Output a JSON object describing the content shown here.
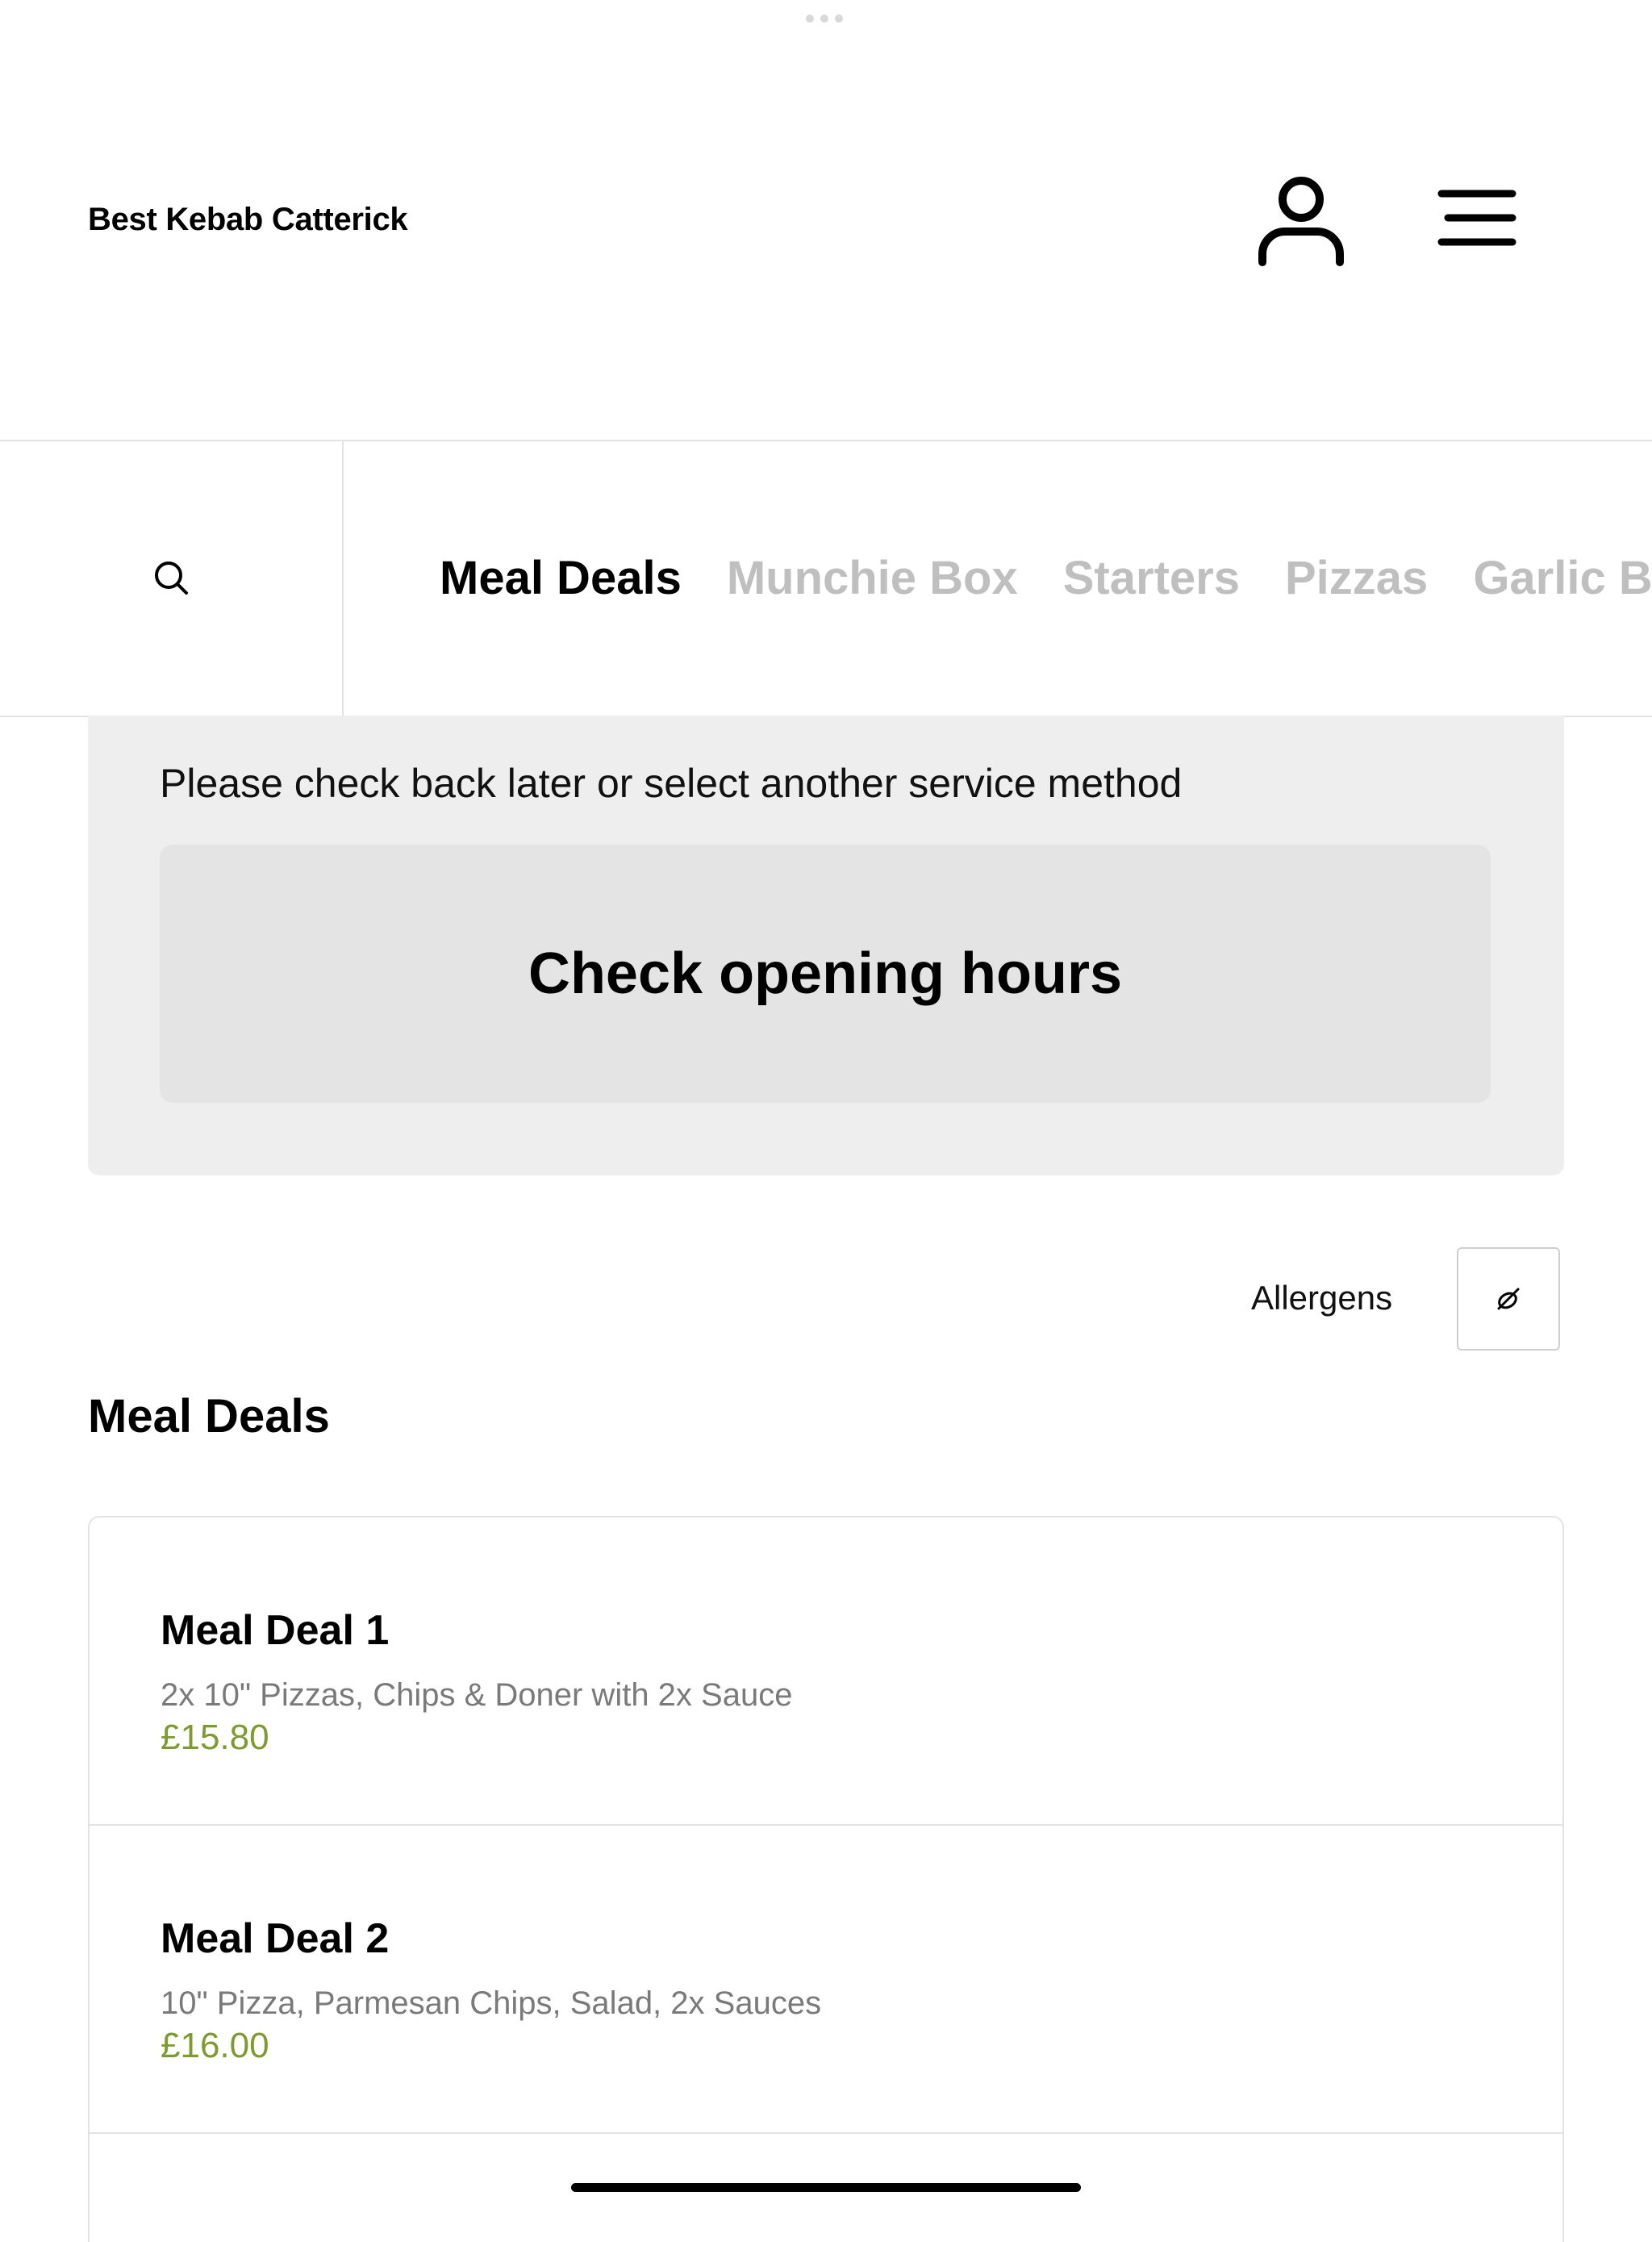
{
  "header": {
    "brand": "Best Kebab Catterick",
    "icons": [
      "user-icon",
      "menu-icon"
    ]
  },
  "nav": {
    "search_icon": "search-icon",
    "tabs": [
      {
        "label": "Meal Deals",
        "active": true
      },
      {
        "label": "Munchie Box",
        "active": false
      },
      {
        "label": "Starters",
        "active": false
      },
      {
        "label": "Pizzas",
        "active": false
      },
      {
        "label": "Garlic B",
        "active": false
      }
    ]
  },
  "notice": {
    "message": "Please check back later or select another service method",
    "button_label": "Check opening hours"
  },
  "allergens": {
    "label": "Allergens",
    "icon": "allergen-icon"
  },
  "section": {
    "title": "Meal Deals"
  },
  "items": [
    {
      "name": "Meal Deal 1",
      "description": "2x 10\" Pizzas, Chips & Doner with 2x Sauce",
      "price": "£15.80"
    },
    {
      "name": "Meal Deal 2",
      "description": "10\" Pizza, Parmesan Chips, Salad, 2x Sauces",
      "price": "£16.00"
    }
  ],
  "colors": {
    "price": "#7f9a2e",
    "inactive_tab": "#bfbfbf",
    "notice_bg": "#eeeeee"
  }
}
